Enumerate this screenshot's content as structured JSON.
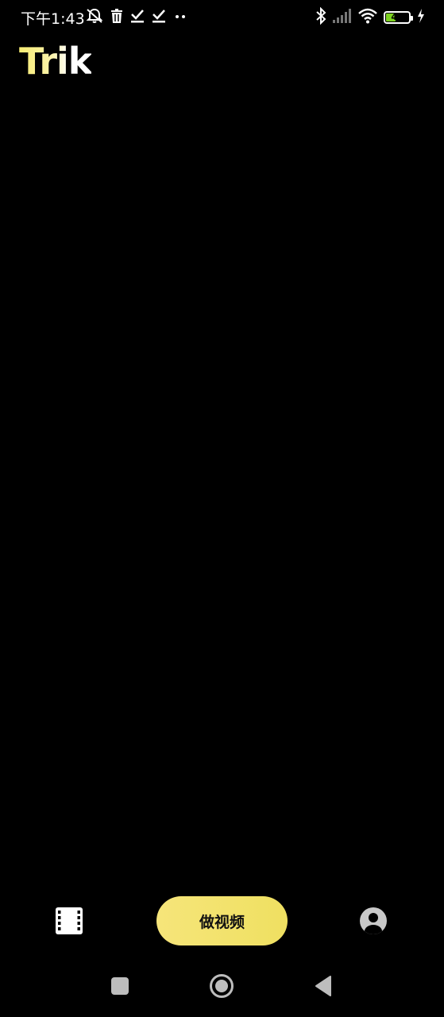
{
  "status_bar": {
    "time": "下午1:43",
    "battery_level": "43",
    "battery_color": "#7ed321",
    "left_icons": [
      "mute-bell-icon",
      "trash-icon",
      "check-download-icon",
      "check-download-icon",
      "more-dots-icon"
    ],
    "right_icons": [
      "bluetooth-icon",
      "signal-icon",
      "wifi-icon",
      "battery-icon",
      "charging-icon"
    ]
  },
  "app": {
    "logo": "Trik",
    "accent_color": "#f6e57a"
  },
  "bottom_nav": {
    "videos_icon": "film-icon",
    "make_video_label": "做视频",
    "profile_icon": "user-circle-icon"
  },
  "system_nav": {
    "recents_icon": "square-icon",
    "home_icon": "circle-home-icon",
    "back_icon": "back-triangle-icon"
  }
}
